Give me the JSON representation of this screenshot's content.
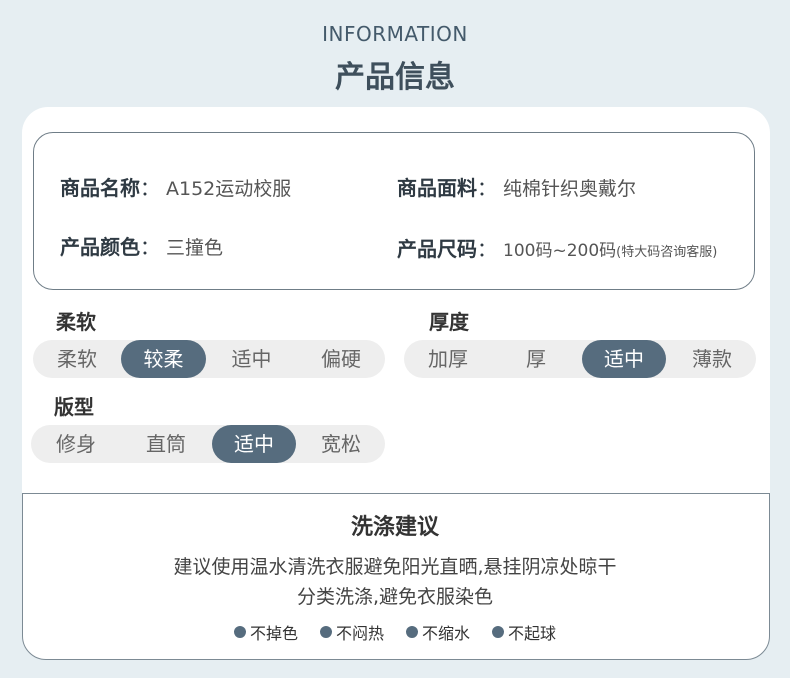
{
  "header": {
    "en": "INFORMATION",
    "cn": "产品信息"
  },
  "info": {
    "name_key": "商品名称",
    "name_val": "A152运动校服",
    "fabric_key": "商品面料",
    "fabric_val": "纯棉针织奥戴尔",
    "color_key": "产品颜色",
    "color_val": "三撞色",
    "size_key": "产品尺码",
    "size_val": "100码~200码",
    "size_note": "(特大码咨询客服)",
    "colon": "："
  },
  "softness": {
    "title": "柔软",
    "options": [
      "柔软",
      "较柔",
      "适中",
      "偏硬"
    ],
    "selected": 1
  },
  "thickness": {
    "title": "厚度",
    "options": [
      "加厚",
      "厚",
      "适中",
      "薄款"
    ],
    "selected": 2
  },
  "fit": {
    "title": "版型",
    "options": [
      "修身",
      "直筒",
      "适中",
      "宽松"
    ],
    "selected": 2
  },
  "wash": {
    "title": "洗涤建议",
    "line1": "建议使用温水清洗衣服避免阳光直晒,悬挂阴凉处晾干",
    "line2": "分类洗涤,避免衣服染色",
    "features": [
      "不掉色",
      "不闷热",
      "不缩水",
      "不起球"
    ]
  },
  "colors": {
    "accent": "#566c7e",
    "pill_bg": "#eeeeee",
    "page_bg": "#e6eef2"
  }
}
